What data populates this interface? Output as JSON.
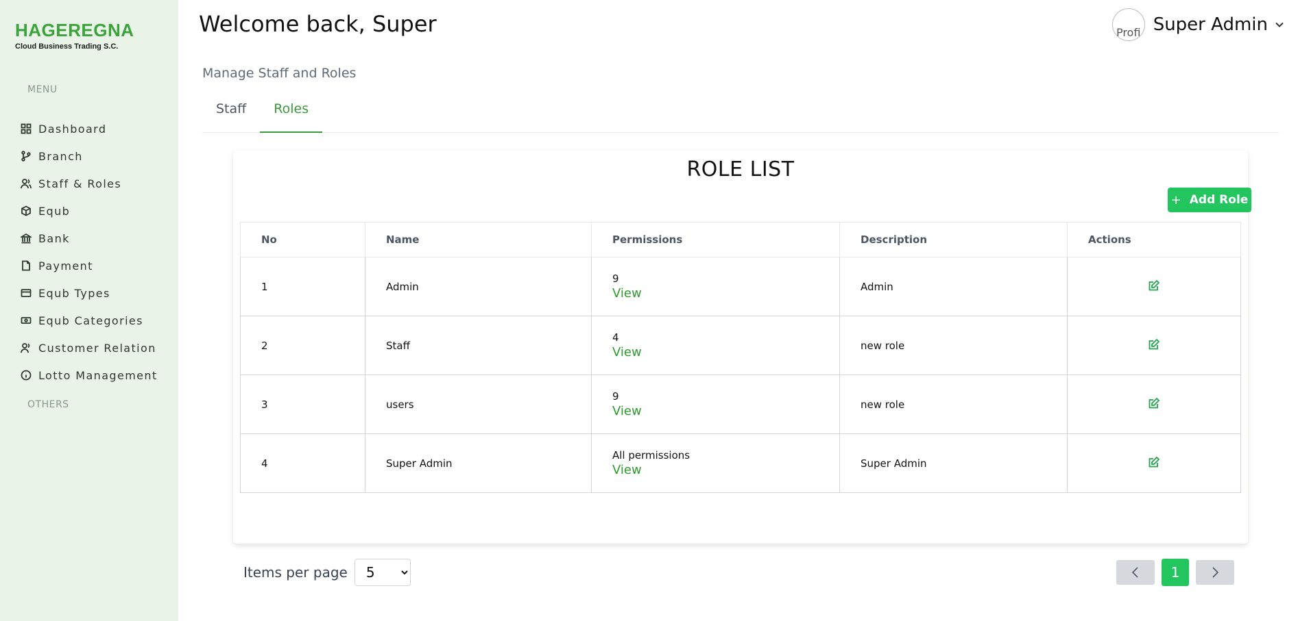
{
  "brand": {
    "name": "HAGEREGNA",
    "subtitle": "Cloud  Business Trading S.C."
  },
  "sidebar": {
    "menu_label": "MENU",
    "others_label": "OTHERS",
    "items": [
      {
        "label": "Dashboard",
        "icon": "dashboard-icon"
      },
      {
        "label": "Branch",
        "icon": "branch-icon"
      },
      {
        "label": "Staff & Roles",
        "icon": "users-icon"
      },
      {
        "label": "Equb",
        "icon": "box-icon"
      },
      {
        "label": "Bank",
        "icon": "bank-icon"
      },
      {
        "label": "Payment",
        "icon": "file-icon"
      },
      {
        "label": "Equb Types",
        "icon": "card-icon"
      },
      {
        "label": "Equb Categories",
        "icon": "cash-icon"
      },
      {
        "label": "Customer Relation",
        "icon": "user-icon"
      },
      {
        "label": "Lotto Management",
        "icon": "info-icon"
      }
    ]
  },
  "header": {
    "welcome": "Welcome back, Super",
    "user_name": "Super Admin",
    "avatar_alt": "Profi"
  },
  "page": {
    "section_title": "Manage Staff and Roles",
    "tabs": [
      {
        "label": "Staff"
      },
      {
        "label": "Roles"
      }
    ],
    "active_tab": "Roles",
    "list_title": "ROLE LIST",
    "add_button": "Add Role"
  },
  "table": {
    "columns": [
      "No",
      "Name",
      "Permissions",
      "Description",
      "Actions"
    ],
    "rows": [
      {
        "no": "1",
        "name": "Admin",
        "permissions": "9",
        "view": "View",
        "description": "Admin"
      },
      {
        "no": "2",
        "name": "Staff",
        "permissions": "4",
        "view": "View",
        "description": "new role"
      },
      {
        "no": "3",
        "name": "users",
        "permissions": "9",
        "view": "View",
        "description": "new role"
      },
      {
        "no": "4",
        "name": "Super Admin",
        "permissions": "All permissions",
        "view": "View",
        "description": "Super Admin"
      }
    ]
  },
  "pagination": {
    "items_per_page_label": "Items per page",
    "items_per_page": "5",
    "current_page": "1"
  },
  "colors": {
    "accent": "#22c55e",
    "sidebar_bg": "#e9f3e8",
    "link": "#2e9a2e"
  }
}
